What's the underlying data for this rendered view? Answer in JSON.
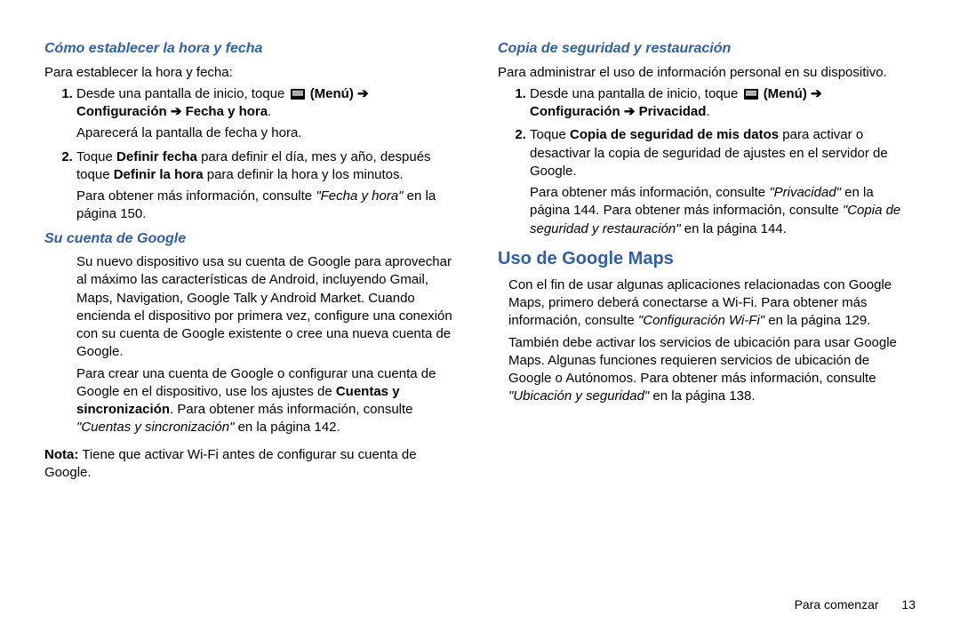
{
  "left": {
    "h_time": "Cómo establecer la hora y fecha",
    "time_intro": "Para establecer la hora y fecha:",
    "li1_a": "Desde una pantalla de inicio, toque ",
    "li1_b": " (Menú) ➔ Configuración ➔ Fecha y hora",
    "li1_c": ".",
    "li1_sub": "Aparecerá la pantalla de fecha y hora.",
    "li2_a": "Toque ",
    "li2_b": "Definir fecha",
    "li2_c": " para definir el día, mes y año, después toque ",
    "li2_d": "Definir la hora",
    "li2_e": " para definir la hora y los minutos.",
    "li2_sub_a": "Para obtener más información, consulte ",
    "li2_sub_b": "\"Fecha y hora\"",
    "li2_sub_c": " en la página 150.",
    "h_google": "Su cuenta de Google",
    "g_p1": "Su nuevo dispositivo usa su cuenta de Google para aprovechar al máximo las características de Android, incluyendo Gmail, Maps, Navigation, Google Talk y Android Market. Cuando encienda el dispositivo por primera vez, configure una conexión con su cuenta de Google existente o cree una nueva cuenta de Google.",
    "g_p2_a": "Para crear una cuenta de Google o configurar una cuenta de Google en el dispositivo, use los ajustes de ",
    "g_p2_b": "Cuentas y sincronización",
    "g_p2_c": ". Para obtener más información, consulte ",
    "g_p2_d": "\"Cuentas y sincronización\"",
    "g_p2_e": " en la página 142.",
    "note_label": "Nota:",
    "note_body": "Tiene que activar Wi-Fi antes de configurar su cuenta de Google."
  },
  "right": {
    "h_backup": "Copia de seguridad y restauración",
    "b_intro": "Para administrar el uso de información personal en su dispositivo.",
    "li1_a": "Desde una pantalla de inicio, toque ",
    "li1_b": " (Menú) ➔ Configuración ➔ Privacidad",
    "li1_c": ".",
    "li2_a": "Toque ",
    "li2_b": "Copia de seguridad de mis datos",
    "li2_c": " para activar o desactivar la copia de seguridad de ajustes en el servidor de Google.",
    "li2_sub_a": "Para obtener más información, consulte ",
    "li2_sub_b": "\"Privacidad\"",
    "li2_sub_c": " en la página 144. Para obtener más información, consulte ",
    "li2_sub_d": "\"Copia de seguridad y restauración\"",
    "li2_sub_e": " en la página 144.",
    "h_maps": "Uso de Google Maps",
    "m_p1_a": "Con el fin de usar algunas aplicaciones relacionadas con Google Maps, primero deberá conectarse a Wi-Fi. Para obtener más información, consulte ",
    "m_p1_b": "\"Configuración Wi-Fi\"",
    "m_p1_c": " en la página 129.",
    "m_p2_a": "También debe activar los servicios de ubicación para usar Google Maps. Algunas funciones requieren servicios de ubicación de Google o Autónomos. Para obtener más información, consulte ",
    "m_p2_b": "\"Ubicación y seguridad\"",
    "m_p2_c": " en la página 138."
  },
  "footer": {
    "section": "Para comenzar",
    "page": "13"
  }
}
